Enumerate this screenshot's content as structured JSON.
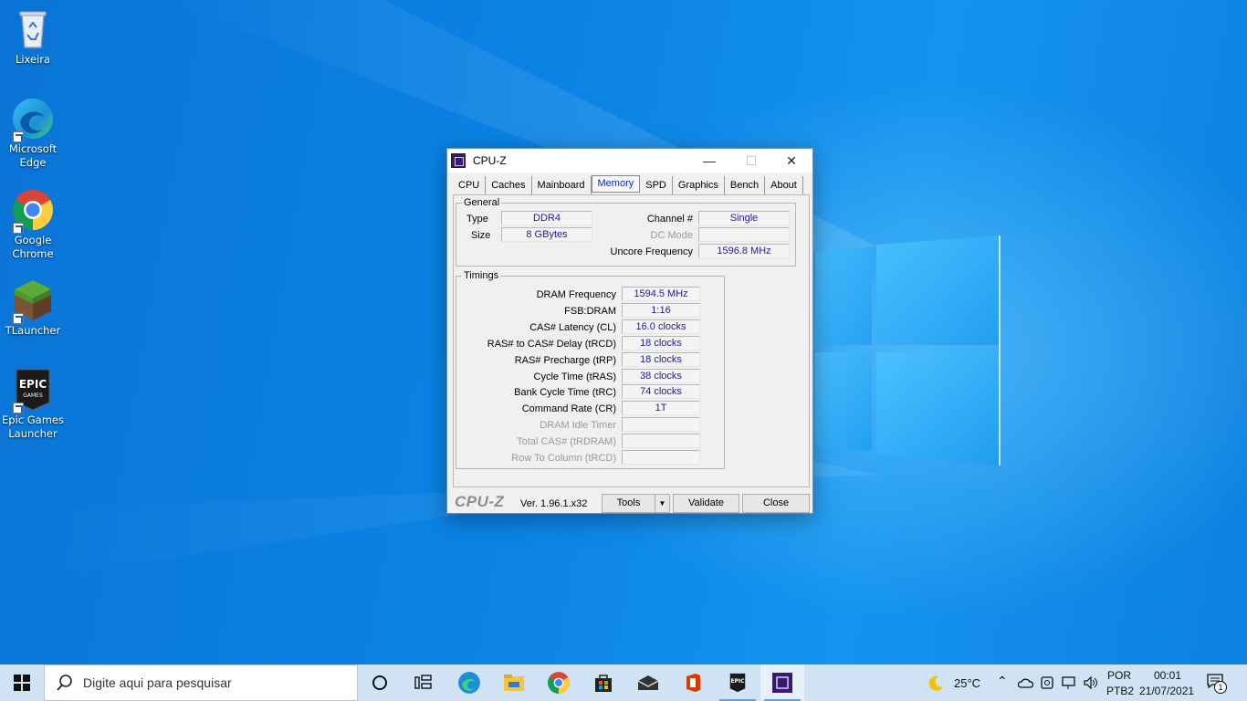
{
  "desktop": {
    "icons": [
      {
        "label": "Lixeira",
        "icon": "recycle-bin-icon"
      },
      {
        "label": "Microsoft\nEdge",
        "line1": "Microsoft",
        "line2": "Edge",
        "icon": "edge-icon"
      },
      {
        "line1": "Google",
        "line2": "Chrome",
        "icon": "chrome-icon"
      },
      {
        "label": "TLauncher",
        "icon": "minecraft-grass-block-icon"
      },
      {
        "line1": "Epic Games",
        "line2": "Launcher",
        "icon": "epic-games-icon"
      }
    ]
  },
  "window": {
    "title": "CPU-Z",
    "controls": {
      "minimize": "—",
      "maximize": "☐",
      "close": "✕"
    },
    "tabs": [
      "CPU",
      "Caches",
      "Mainboard",
      "Memory",
      "SPD",
      "Graphics",
      "Bench",
      "About"
    ],
    "active_tab": "Memory",
    "general": {
      "legend": "General",
      "type_label": "Type",
      "type_value": "DDR4",
      "size_label": "Size",
      "size_value": "8 GBytes",
      "channel_label": "Channel #",
      "channel_value": "Single",
      "dcmode_label": "DC Mode",
      "dcmode_value": "",
      "uncore_label": "Uncore Frequency",
      "uncore_value": "1596.8 MHz"
    },
    "timings": {
      "legend": "Timings",
      "rows": [
        {
          "label": "DRAM Frequency",
          "value": "1594.5 MHz",
          "enabled": true
        },
        {
          "label": "FSB:DRAM",
          "value": "1:16",
          "enabled": true
        },
        {
          "label": "CAS# Latency (CL)",
          "value": "16.0 clocks",
          "enabled": true
        },
        {
          "label": "RAS# to CAS# Delay (tRCD)",
          "value": "18 clocks",
          "enabled": true
        },
        {
          "label": "RAS# Precharge (tRP)",
          "value": "18 clocks",
          "enabled": true
        },
        {
          "label": "Cycle Time (tRAS)",
          "value": "38 clocks",
          "enabled": true
        },
        {
          "label": "Bank Cycle Time (tRC)",
          "value": "74 clocks",
          "enabled": true
        },
        {
          "label": "Command Rate (CR)",
          "value": "1T",
          "enabled": true
        },
        {
          "label": "DRAM Idle Timer",
          "value": "",
          "enabled": false
        },
        {
          "label": "Total CAS# (tRDRAM)",
          "value": "",
          "enabled": false
        },
        {
          "label": "Row To Column (tRCD)",
          "value": "",
          "enabled": false
        }
      ]
    },
    "footer": {
      "brand": "CPU-Z",
      "version": "Ver. 1.96.1.x32",
      "tools_label": "Tools",
      "validate_label": "Validate",
      "close_label": "Close"
    }
  },
  "taskbar": {
    "search_placeholder": "Digite aqui para pesquisar",
    "apps": [
      "cortana-icon",
      "task-view-icon",
      "edge-icon",
      "file-explorer-icon",
      "chrome-icon",
      "store-icon",
      "mail-icon",
      "office-icon",
      "epic-games-icon",
      "cpu-z-icon"
    ],
    "weather": "25°C",
    "language_line1": "POR",
    "language_line2": "PTB2",
    "time": "00:01",
    "date": "21/07/2021",
    "notification_count": "1"
  },
  "colors": {
    "desktop_blue": "#0a78d7",
    "taskbar_bg": "#cfe3f4",
    "value_text": "#1e1a9a",
    "active_tab_text": "#0b2bbf"
  }
}
